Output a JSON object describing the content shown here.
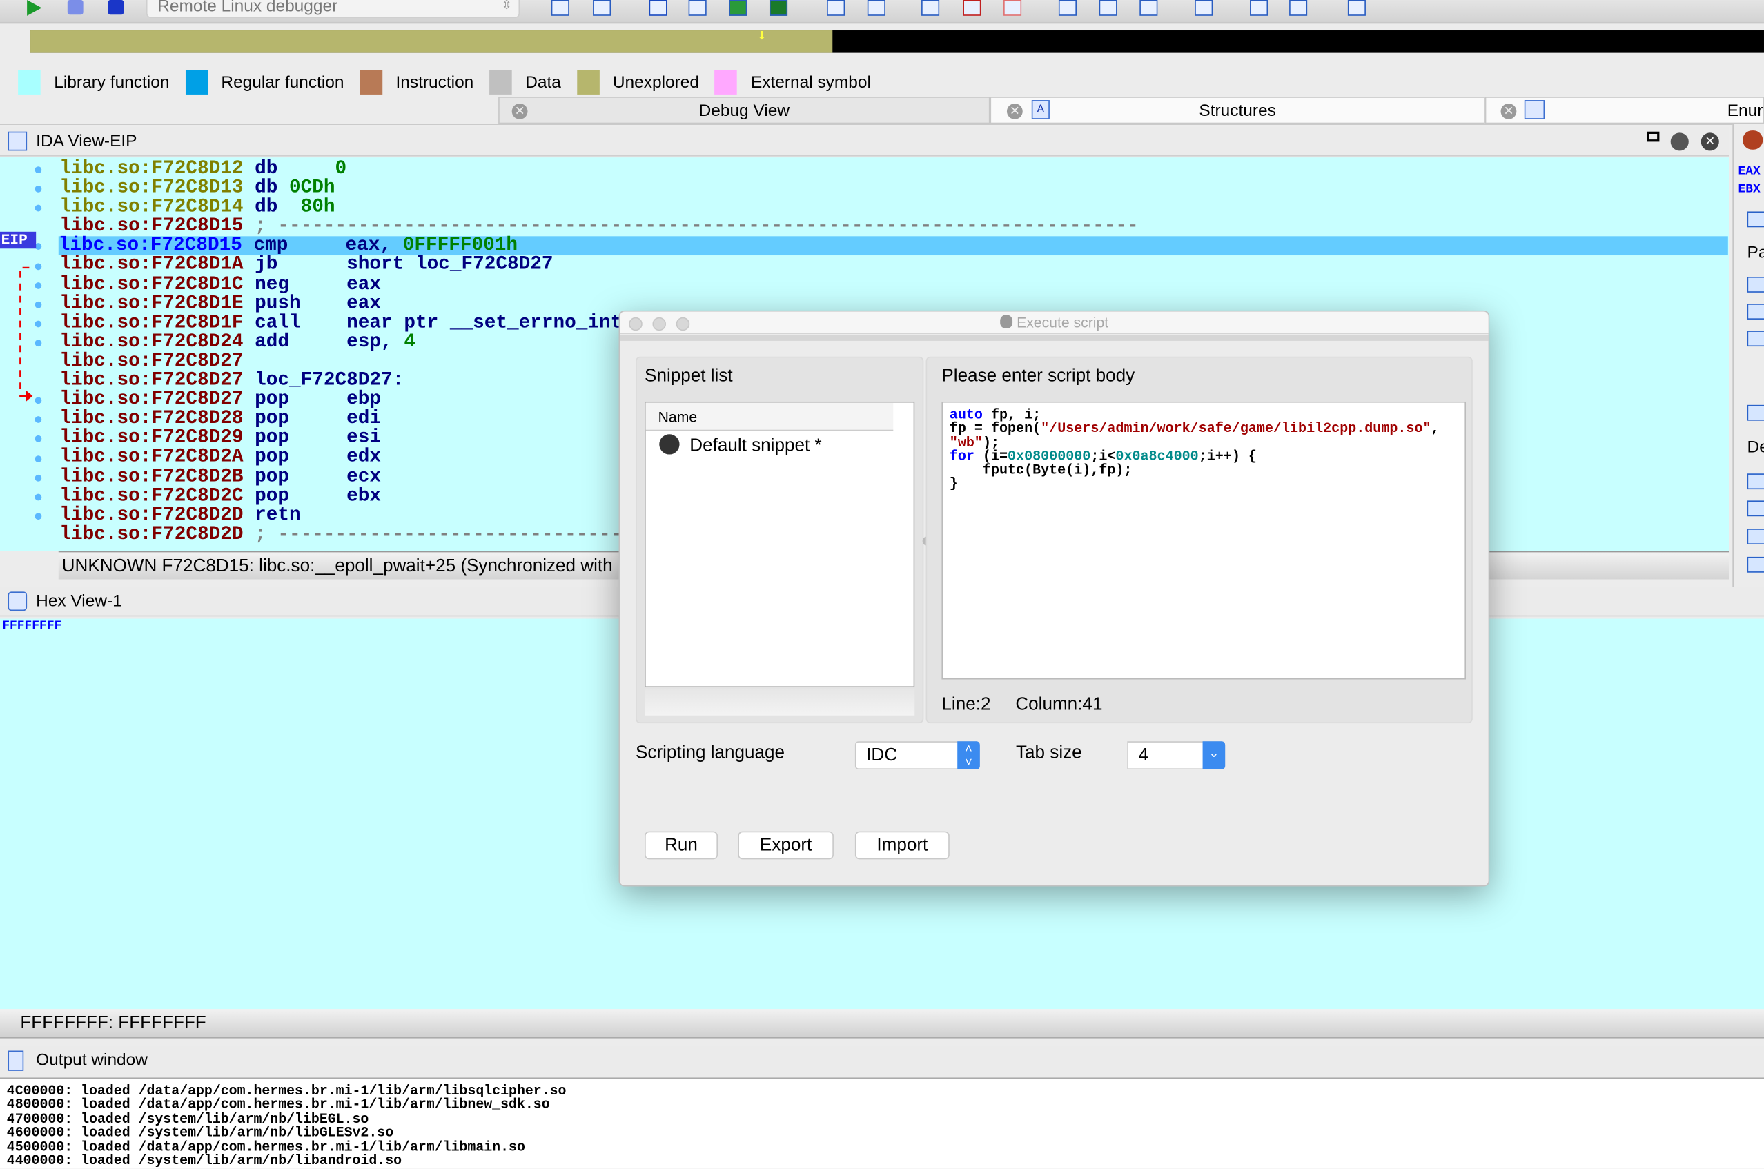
{
  "toolbar": {
    "debugger_select": "Remote Linux debugger"
  },
  "legend": [
    {
      "label": "Library function",
      "color": "#a8ffff"
    },
    {
      "label": "Regular function",
      "color": "#00a0e6"
    },
    {
      "label": "Instruction",
      "color": "#b87a56"
    },
    {
      "label": "Data",
      "color": "#c0c0c0"
    },
    {
      "label": "Unexplored",
      "color": "#b6b66d"
    },
    {
      "label": "External symbol",
      "color": "#ffa8ff"
    }
  ],
  "tabs": {
    "debug_view": "Debug View",
    "structures": "Structures",
    "enums": "Enur"
  },
  "ida_view": {
    "title": "IDA View-EIP",
    "eip_label": "EIP",
    "lines": [
      {
        "addr": "libc.so:F72C8D12",
        "kind": "data",
        "mn": "db",
        "op": "",
        "num": "     0"
      },
      {
        "addr": "libc.so:F72C8D13",
        "kind": "data",
        "mn": "db",
        "op": "",
        "num": " 0CDh"
      },
      {
        "addr": "libc.so:F72C8D14",
        "kind": "data",
        "mn": "db",
        "op": "",
        "num": "  80h"
      },
      {
        "addr": "libc.so:F72C8D15",
        "kind": "code",
        "mn": "",
        "op": "",
        "num": "",
        "cmt": "; ---------------------------------------------------------------------------"
      },
      {
        "addr": "libc.so:F72C8D15",
        "kind": "cur",
        "mn": "cmp",
        "op": "eax, ",
        "num": "0FFFFF001h"
      },
      {
        "addr": "libc.so:F72C8D1A",
        "kind": "code",
        "mn": "jb",
        "op": "short loc_F72C8D27",
        "num": ""
      },
      {
        "addr": "libc.so:F72C8D1C",
        "kind": "code",
        "mn": "neg",
        "op": "eax",
        "num": ""
      },
      {
        "addr": "libc.so:F72C8D1E",
        "kind": "code",
        "mn": "push",
        "op": "eax",
        "num": ""
      },
      {
        "addr": "libc.so:F72C8D1F",
        "kind": "code",
        "mn": "call",
        "op": "near ptr __set_errno_internal",
        "num": ""
      },
      {
        "addr": "libc.so:F72C8D24",
        "kind": "code",
        "mn": "add",
        "op": "esp, ",
        "num": "4"
      },
      {
        "addr": "libc.so:F72C8D27",
        "kind": "code",
        "mn": "",
        "op": "",
        "num": ""
      },
      {
        "addr": "libc.so:F72C8D27",
        "kind": "code",
        "mn": "loc_F72C8D27:",
        "op": "",
        "num": ""
      },
      {
        "addr": "libc.so:F72C8D27",
        "kind": "code",
        "mn": "pop",
        "op": "ebp",
        "num": ""
      },
      {
        "addr": "libc.so:F72C8D28",
        "kind": "code",
        "mn": "pop",
        "op": "edi",
        "num": ""
      },
      {
        "addr": "libc.so:F72C8D29",
        "kind": "code",
        "mn": "pop",
        "op": "esi",
        "num": ""
      },
      {
        "addr": "libc.so:F72C8D2A",
        "kind": "code",
        "mn": "pop",
        "op": "edx",
        "num": ""
      },
      {
        "addr": "libc.so:F72C8D2B",
        "kind": "code",
        "mn": "pop",
        "op": "ecx",
        "num": ""
      },
      {
        "addr": "libc.so:F72C8D2C",
        "kind": "code",
        "mn": "pop",
        "op": "ebx",
        "num": ""
      },
      {
        "addr": "libc.so:F72C8D2D",
        "kind": "code",
        "mn": "retn",
        "op": "",
        "num": ""
      },
      {
        "addr": "libc.so:F72C8D2D",
        "kind": "code",
        "mn": "",
        "op": "",
        "num": "",
        "cmt": "; ---------------------------------------------------------------------------"
      }
    ],
    "status": "UNKNOWN  F72C8D15: libc.so:__epoll_pwait+25  (Synchronized with Hex View-1)"
  },
  "hex_view": {
    "title": "Hex View-1",
    "line": "FFFFFFFF",
    "status": "FFFFFFFF: FFFFFFFF"
  },
  "output": {
    "title": "Output window",
    "lines": [
      "4C00000: loaded /data/app/com.hermes.br.mi-1/lib/arm/libsqlcipher.so",
      "4800000: loaded /data/app/com.hermes.br.mi-1/lib/arm/libnew_sdk.so",
      "4700000: loaded /system/lib/arm/nb/libEGL.so",
      "4600000: loaded /system/lib/arm/nb/libGLESv2.so",
      "4500000: loaded /data/app/com.hermes.br.mi-1/lib/arm/libmain.so",
      "4400000: loaded /system/lib/arm/nb/libandroid.so"
    ]
  },
  "right_panel": {
    "reg1": "EAX",
    "reg2": "EBX",
    "section1": "Pa",
    "section2": "De"
  },
  "dialog": {
    "title": "Execute script",
    "snippet_list_label": "Snippet list",
    "snippet_column": "Name",
    "snippets": [
      "Default snippet *"
    ],
    "script_body_label": "Please enter script body",
    "code": [
      [
        [
          "auto",
          "kw"
        ],
        [
          " fp, i;",
          ""
        ]
      ],
      [
        [
          "fp = fopen(",
          ""
        ],
        [
          "\"/Users/admin/work/safe/game/libil2cpp.dump.so\"",
          "str"
        ],
        [
          ",",
          ""
        ]
      ],
      [
        [
          "\"wb\"",
          "str"
        ],
        [
          ");",
          ""
        ]
      ],
      [
        [
          "for",
          "kw"
        ],
        [
          " (i=",
          ""
        ],
        [
          "0x08000000",
          "hex"
        ],
        [
          ";i<",
          ""
        ],
        [
          "0x0a8c4000",
          "hex"
        ],
        [
          ";i++) {",
          ""
        ]
      ],
      [
        [
          "    fputc(Byte(i),fp);",
          ""
        ]
      ],
      [
        [
          "}",
          ""
        ]
      ]
    ],
    "line_label": "Line:2",
    "column_label": "Column:41",
    "scripting_language_label": "Scripting language",
    "scripting_language": "IDC",
    "tab_size_label": "Tab size",
    "tab_size": "4",
    "run": "Run",
    "export": "Export",
    "import": "Import"
  }
}
